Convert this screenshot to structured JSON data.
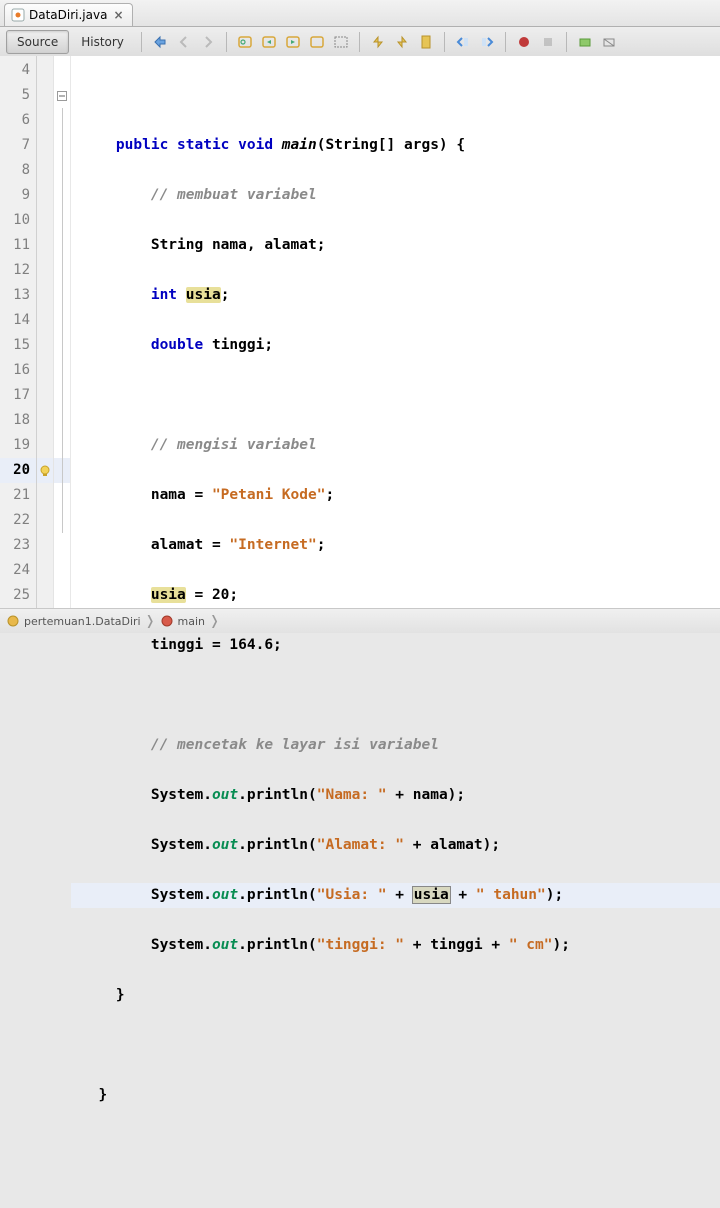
{
  "tab": {
    "filename": "DataDiri.java"
  },
  "toolbar": {
    "source": "Source",
    "history": "History"
  },
  "gutter_start": 4,
  "gutter_end": 25,
  "highlighted_line": 20,
  "code": {
    "l5": {
      "sig1": "public static void",
      "fn": "main",
      "sig2": "(String[] args) {"
    },
    "l6": {
      "cm": "// membuat variabel"
    },
    "l7": {
      "txt": "String nama, alamat;"
    },
    "l8": {
      "kw": "int",
      "mk": "usia",
      "tail": ";"
    },
    "l9": {
      "kw": "double",
      "tail": " tinggi;"
    },
    "l11": {
      "cm": "// mengisi variabel"
    },
    "l12": {
      "lhs": "nama = ",
      "str": "\"Petani Kode\"",
      "tail": ";"
    },
    "l13": {
      "lhs": "alamat = ",
      "str": "\"Internet\"",
      "tail": ";"
    },
    "l14": {
      "mk": "usia",
      "tail": " = 20;"
    },
    "l15": {
      "txt": "tinggi = 164.6;"
    },
    "l17": {
      "cm": "// mencetak ke layar isi variabel"
    },
    "l18": {
      "a": "System.",
      "o": "out",
      "b": ".println(",
      "s": "\"Nama: \"",
      "c": " + nama);"
    },
    "l19": {
      "a": "System.",
      "o": "out",
      "b": ".println(",
      "s": "\"Alamat: \"",
      "c": " + alamat);"
    },
    "l20": {
      "a": "System.",
      "o": "out",
      "b": ".println(",
      "s": "\"Usia: \"",
      "m": " + ",
      "mk": "usia",
      "n": " + ",
      "s2": "\" tahun\"",
      "c": ");"
    },
    "l21": {
      "a": "System.",
      "o": "out",
      "b": ".println(",
      "s": "\"tinggi: \"",
      "m": " + tinggi + ",
      "s2": "\" cm\"",
      "c": ");"
    },
    "l22": {
      "txt": "}"
    },
    "l24": {
      "txt": "}"
    }
  },
  "breadcrumb": {
    "pkg": "pertemuan1.DataDiri",
    "method": "main"
  }
}
